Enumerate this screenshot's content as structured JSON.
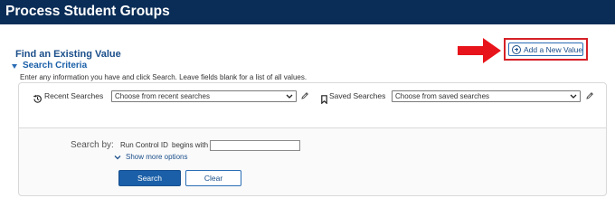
{
  "header": {
    "title": "Process Student Groups"
  },
  "find": {
    "title": "Find an Existing Value",
    "criteria_label": "Search Criteria",
    "instructions": "Enter any information you have and click Search. Leave fields blank for a list of all values."
  },
  "add_new": {
    "label": "Add a New Value"
  },
  "recent": {
    "label": "Recent Searches",
    "selected": "Choose from recent searches"
  },
  "saved": {
    "label": "Saved Searches",
    "selected": "Choose from saved searches"
  },
  "search_by": {
    "label": "Search by:",
    "field": "Run Control ID",
    "operator": "begins with",
    "value": "",
    "more_options": "Show more options"
  },
  "buttons": {
    "search": "Search",
    "clear": "Clear"
  },
  "colors": {
    "header_bg": "#0a2d57",
    "accent": "#1a5fa8",
    "highlight": "#d62027"
  },
  "icons": [
    "history-icon",
    "bookmark-icon",
    "pencil-icon",
    "add-circle-icon",
    "chevron-down-icon",
    "arrow-right-icon"
  ]
}
